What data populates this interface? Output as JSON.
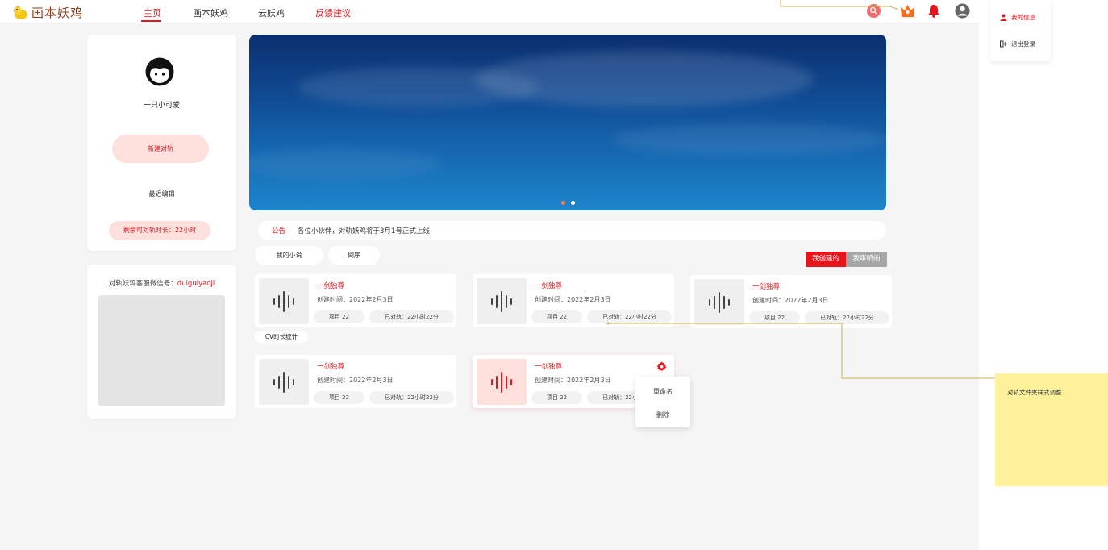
{
  "app": {
    "logo_text": "画本妖鸡"
  },
  "nav": [
    {
      "label": "主页"
    },
    {
      "label": "画本妖鸡"
    },
    {
      "label": "云妖鸡"
    },
    {
      "label": "反馈建议"
    }
  ],
  "profile": {
    "name": "一只小可爱",
    "new_button": "新建对轨",
    "recent_label": "最近编辑",
    "remaining": "剩余可对轨时长：22小时"
  },
  "service": {
    "label": "对轨妖鸡客服微信号：",
    "wechat": "duiguiyaoji"
  },
  "notice": {
    "tag": "公告",
    "text": "各位小伙伴，对轨妖鸡将于3月1号正式上线"
  },
  "filters": {
    "my_novels": "我的小说",
    "reverse": "倒序"
  },
  "tabs": {
    "created": "我创建的",
    "reviewed": "我审听的"
  },
  "cv_stats": "CV时长统计",
  "files": [
    {
      "title": "一剑独尊",
      "date": "创建时间：2022年2月3日",
      "items": "项目 22",
      "duration": "已对轨：22小时22分"
    },
    {
      "title": "一剑独尊",
      "date": "创建时间：2022年2月3日",
      "items": "项目 22",
      "duration": "已对轨：22小时22分"
    },
    {
      "title": "一剑独尊",
      "date": "创建时间：2022年2月3日",
      "items": "项目 22",
      "duration": "已对轨：22小时22分"
    },
    {
      "title": "一剑独尊",
      "date": "创建时间：2022年2月3日",
      "items": "项目 22",
      "duration": "已对轨：22小时22分"
    },
    {
      "title": "一剑独尊",
      "date": "创建时间：2022年2月3日",
      "items": "项目 22",
      "duration": "已对轨：22小时22分"
    }
  ],
  "context_menu": {
    "rename": "重命名",
    "delete": "删除"
  },
  "user_menu": {
    "my_info": "我的信息",
    "logout": "退出登录"
  },
  "sticky_note": "对轨文件夹样式调整",
  "colors": {
    "accent": "#e8141c",
    "accent_soft": "#fde0dc",
    "sticky": "#fff29a"
  },
  "icons": [
    "logo-chick-icon",
    "search-icon",
    "crown-icon",
    "bell-icon",
    "user-icon",
    "face-avatar-icon",
    "waveform-icon",
    "gear-icon",
    "person-icon",
    "logout-icon"
  ]
}
